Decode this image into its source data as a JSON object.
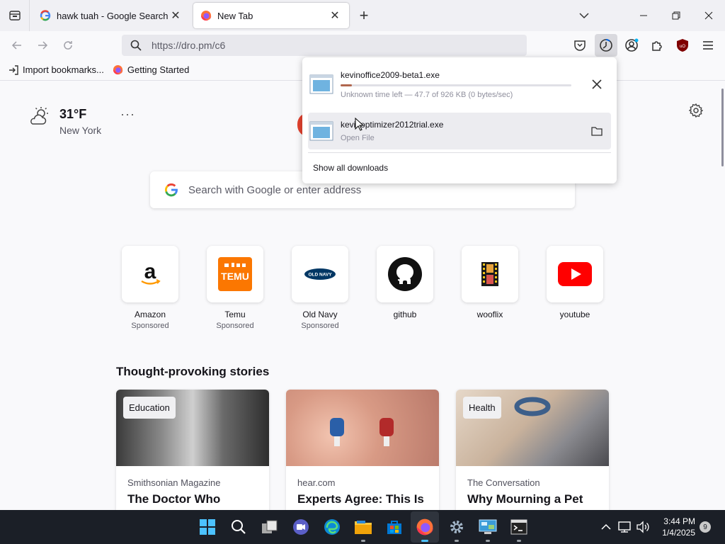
{
  "tabs": [
    {
      "title": "hawk tuah - Google Search",
      "active": false,
      "favicon": "google-icon"
    },
    {
      "title": "New Tab",
      "active": true,
      "favicon": "firefox-icon"
    }
  ],
  "navbar": {
    "url": "https://dro.pm/c6"
  },
  "bookmarks": [
    {
      "label": "Import bookmarks...",
      "icon": "import-icon"
    },
    {
      "label": "Getting Started",
      "icon": "firefox-icon"
    }
  ],
  "weather": {
    "temp": "31°F",
    "city": "New York"
  },
  "search": {
    "placeholder": "Search with Google or enter address"
  },
  "shortcuts": [
    {
      "label": "Amazon",
      "sponsored": "Sponsored",
      "icon": "amazon-logo"
    },
    {
      "label": "Temu",
      "sponsored": "Sponsored",
      "icon": "temu-logo"
    },
    {
      "label": "Old Navy",
      "sponsored": "Sponsored",
      "icon": "oldnavy-logo"
    },
    {
      "label": "github",
      "sponsored": "",
      "icon": "github-logo"
    },
    {
      "label": "wooflix",
      "sponsored": "",
      "icon": "film-icon"
    },
    {
      "label": "youtube",
      "sponsored": "",
      "icon": "youtube-logo"
    }
  ],
  "stories": {
    "heading": "Thought-provoking stories",
    "cards": [
      {
        "badge": "Education",
        "source": "Smithsonian Magazine",
        "headline": "The Doctor Who"
      },
      {
        "badge": "",
        "source": "hear.com",
        "headline": "Experts Agree: This Is"
      },
      {
        "badge": "Health",
        "source": "The Conversation",
        "headline": "Why Mourning a Pet"
      }
    ]
  },
  "downloads": {
    "items": [
      {
        "name": "kevinoffice2009-beta1.exe",
        "status": "Unknown time left — 47.7 of 926 KB (0 bytes/sec)",
        "progress": 0.05
      },
      {
        "name": "kevinoptimizer2012trial.exe",
        "status": "Open File"
      }
    ],
    "show_all": "Show all downloads"
  },
  "taskbar": {
    "time": "3:44 PM",
    "date": "1/4/2025",
    "notifications": "9"
  },
  "colors": {
    "accent": "#0061e0",
    "progress": "#b0674e",
    "youtube": "#ff0000",
    "temu": "#fb7701",
    "taskbar": "#1b1f27"
  }
}
